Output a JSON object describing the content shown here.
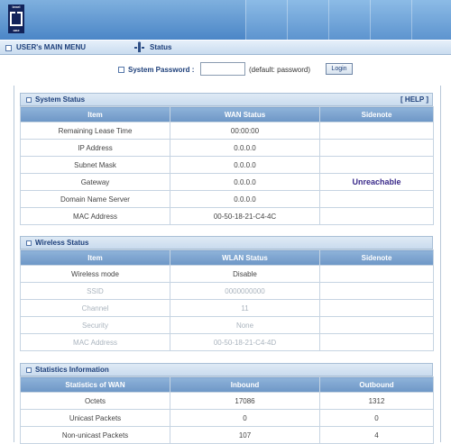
{
  "header": {
    "logo_top": "level",
    "logo_bottom": "one"
  },
  "menubar": {
    "menu_title": "USER's MAIN MENU",
    "status_label": "Status"
  },
  "password": {
    "label": "System Password :",
    "value": "",
    "hint": "(default: password)",
    "login_label": "Login"
  },
  "system_status": {
    "title": "System Status",
    "help": "[ HELP ]",
    "headers": [
      "Item",
      "WAN Status",
      "Sidenote"
    ],
    "rows": [
      [
        "Remaining Lease Time",
        "00:00:00",
        ""
      ],
      [
        "IP Address",
        "0.0.0.0",
        ""
      ],
      [
        "Subnet Mask",
        "0.0.0.0",
        ""
      ],
      [
        "Gateway",
        "0.0.0.0",
        "Unreachable"
      ],
      [
        "Domain Name Server",
        "0.0.0.0",
        ""
      ],
      [
        "MAC Address",
        "00-50-18-21-C4-4C",
        ""
      ]
    ]
  },
  "wireless_status": {
    "title": "Wireless Status",
    "headers": [
      "Item",
      "WLAN Status",
      "Sidenote"
    ],
    "rows": [
      [
        "Wireless mode",
        "Disable",
        ""
      ],
      [
        "SSID",
        "0000000000",
        ""
      ],
      [
        "Channel",
        "11",
        ""
      ],
      [
        "Security",
        "None",
        ""
      ],
      [
        "MAC Address",
        "00-50-18-21-C4-4D",
        ""
      ]
    ]
  },
  "statistics": {
    "title": "Statistics Information",
    "headers": [
      "Statistics of WAN",
      "Inbound",
      "Outbound"
    ],
    "rows": [
      [
        "Octets",
        "17086",
        "1312"
      ],
      [
        "Unicast Packets",
        "0",
        "0"
      ],
      [
        "Non-unicast Packets",
        "107",
        "4"
      ]
    ]
  },
  "colors": {
    "header_blue": "#4b86c7",
    "table_header": "#7aa2cf",
    "alert": "#3a2a8a"
  }
}
